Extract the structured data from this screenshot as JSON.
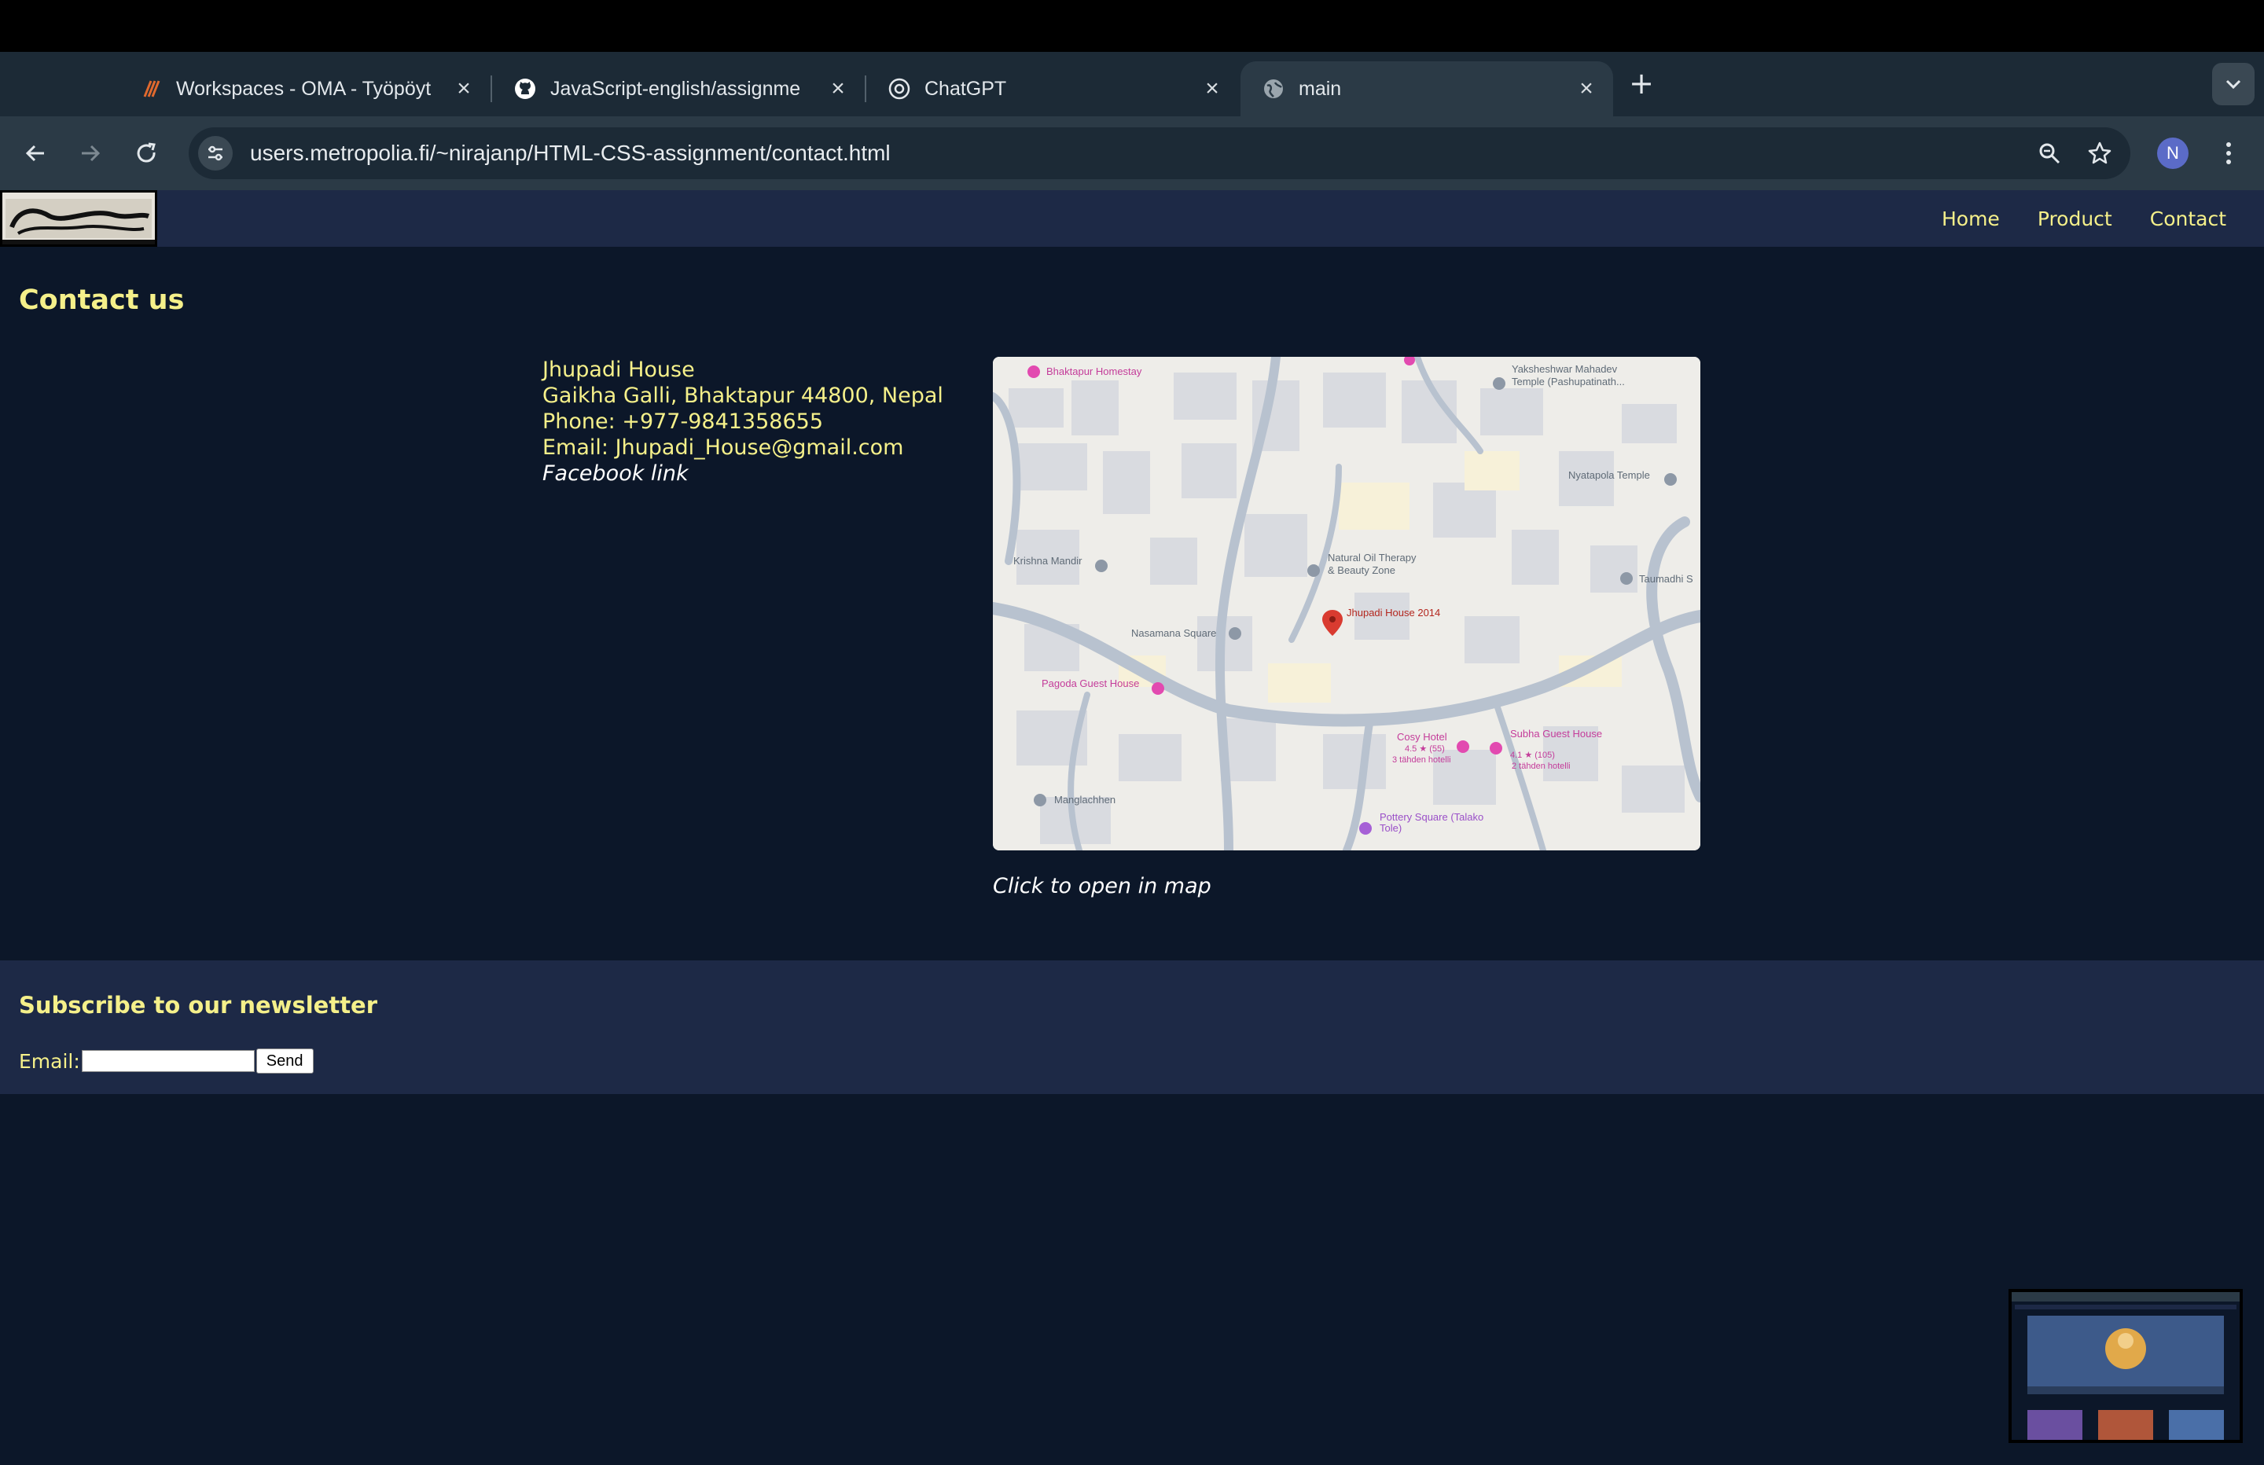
{
  "browser": {
    "tabs": [
      {
        "title": "Workspaces - OMA - Työpöyt",
        "icon": "oma-icon",
        "active": false
      },
      {
        "title": "JavaScript-english/assignme",
        "icon": "github-icon",
        "active": false
      },
      {
        "title": "ChatGPT",
        "icon": "chatgpt-icon",
        "active": false
      },
      {
        "title": "main",
        "icon": "globe-icon",
        "active": true
      }
    ],
    "close_glyph": "×",
    "new_tab_glyph": "+",
    "url": "users.metropolia.fi/~nirajanp/HTML-CSS-assignment/contact.html",
    "profile_initial": "N"
  },
  "site": {
    "nav": {
      "home": "Home",
      "product": "Product",
      "contact": "Contact"
    },
    "page_title": "Contact us",
    "contact": {
      "name": "Jhupadi House",
      "address": "Gaikha Galli, Bhaktapur 44800, Nepal",
      "phone": "Phone: +977-9841358655",
      "email": "Email: Jhupadi_House@gmail.com",
      "facebook": "Facebook link"
    },
    "map": {
      "caption": "Click to open in map",
      "labels": {
        "bhaktapur_homestay": "Bhaktapur Homestay",
        "yaksheshwar": "Yaksheshwar Mahadev",
        "yaksheshwar_2": "Temple (Pashupatinath...",
        "nyatapola": "Nyatapola Temple",
        "krishna_mandir": "Krishna Mandir",
        "natural_oil": "Natural Oil Therapy",
        "natural_oil_2": "& Beauty Zone",
        "taumadhi": "Taumadhi S",
        "jhupadi": "Jhupadi House 2014",
        "nasamana": "Nasamana Square",
        "pagoda": "Pagoda Guest House",
        "cosy": "Cosy Hotel",
        "cosy_rating": "4.5 ★ (55)",
        "cosy_type": "3 tähden hotelli",
        "subha": "Subha Guest House",
        "subha_rating": "4.1 ★ (105)",
        "subha_type": "2 tähden hotelli",
        "manglachhen": "Manglachhen",
        "pottery": "Pottery Square (Talako",
        "pottery_2": "Tole)"
      }
    },
    "newsletter": {
      "heading": "Subscribe to our newsletter",
      "email_label": "Email:",
      "email_value": "",
      "send_label": "Send"
    }
  },
  "colors": {
    "accent_text": "#f5f08a",
    "page_bg": "#0c1729",
    "header_bg": "#1d2946"
  }
}
